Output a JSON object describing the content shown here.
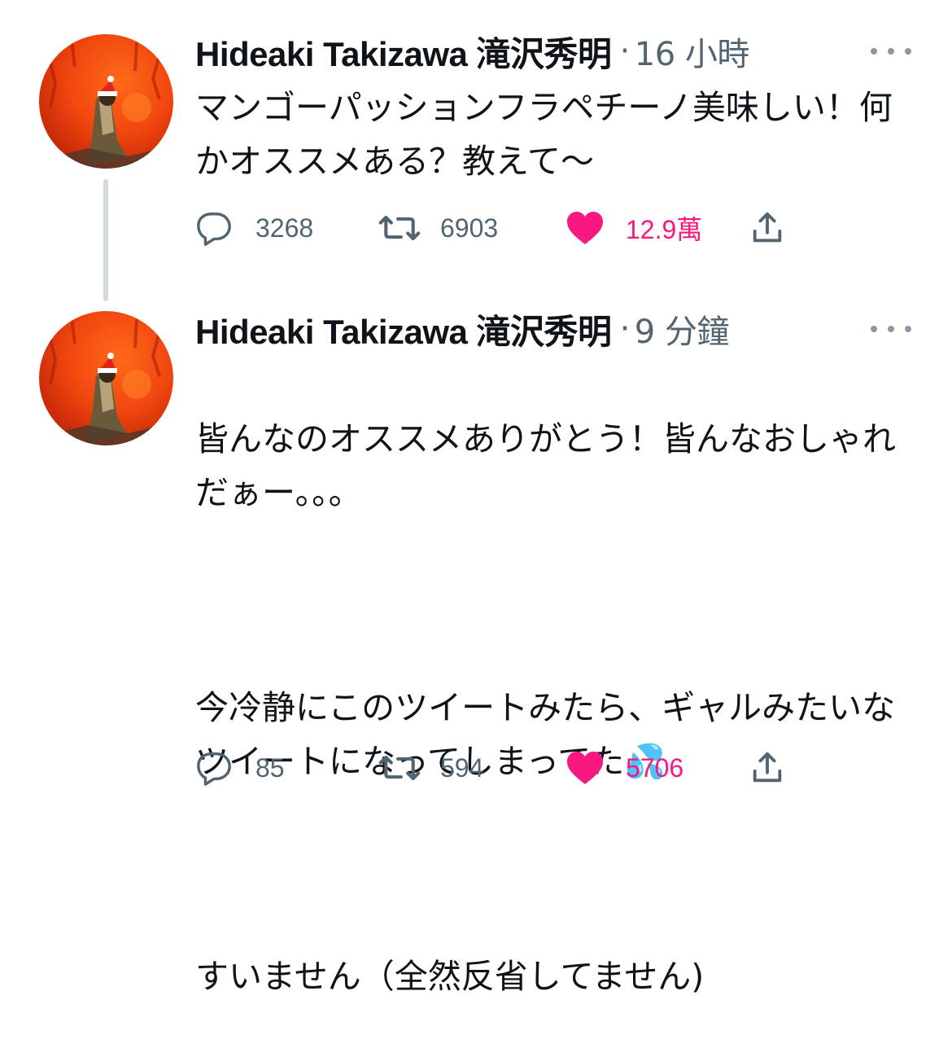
{
  "colors": {
    "text": "#0f1419",
    "muted": "#536471",
    "like": "#f91880",
    "thread_line": "#cfd9de"
  },
  "tweets": [
    {
      "author": "Hideaki Takizawa 滝沢秀明",
      "separator": "·",
      "time": "16 小時",
      "text": "マンゴーパッションフラペチーノ美味しい！何かオススメある？教えて〜",
      "replies": "3268",
      "retweets": "6903",
      "likes": "12.9萬",
      "liked": true,
      "icons": {
        "reply": "reply-icon",
        "retweet": "retweet-icon",
        "like": "heart-icon",
        "share": "share-icon",
        "more": "more-icon"
      }
    },
    {
      "author": "Hideaki Takizawa 滝沢秀明",
      "separator": "·",
      "time": "9 分鐘",
      "text_lines": [
        "皆んなのオススメありがとう！皆んなおしゃれだぁー。。。",
        "今冷静にこのツイートみたら、ギャルみたいなツイートになってしまってた💦",
        "すいません（全然反省してません)"
      ],
      "replies": "85",
      "retweets": "594",
      "likes": "5706",
      "liked": true,
      "icons": {
        "reply": "reply-icon",
        "retweet": "retweet-icon",
        "like": "heart-icon",
        "share": "share-icon",
        "more": "more-icon"
      }
    }
  ]
}
